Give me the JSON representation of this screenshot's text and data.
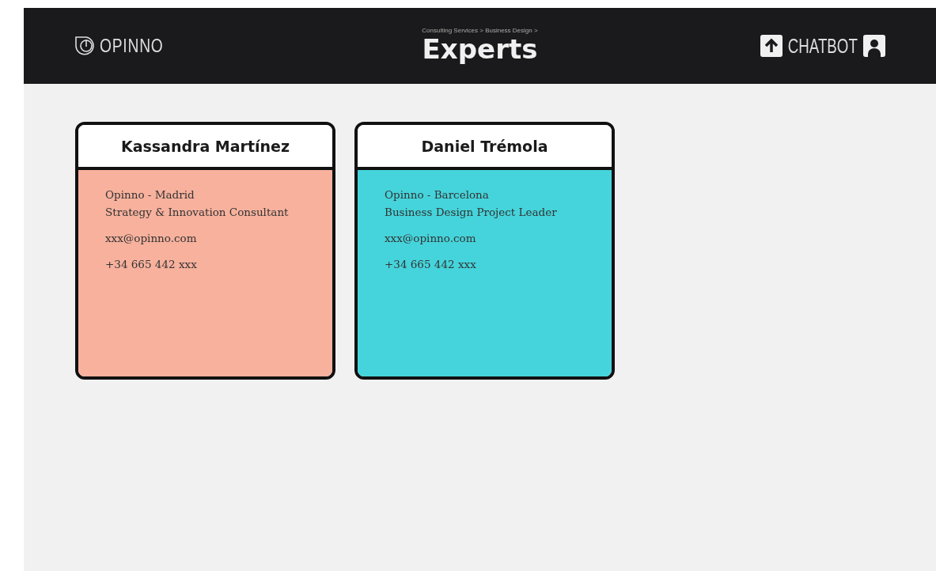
{
  "header": {
    "logo": "OPINNO",
    "breadcrumb": "Consulting Services > Business Design >",
    "title": "Experts",
    "chatbot": "CHATBOT"
  },
  "experts": [
    {
      "name": "Kassandra Martínez",
      "office": "Opinno - Madrid",
      "role": "Strategy & Innovation Consultant",
      "email": "xxx@opinno.com",
      "phone": "+34 665 442 xxx",
      "color": "#f7b19d"
    },
    {
      "name": "Daniel Trémola",
      "office": "Opinno - Barcelona",
      "role": "Business Design Project Leader",
      "email": "xxx@opinno.com",
      "phone": "+34 665 442 xxx",
      "color": "#45d4db"
    }
  ]
}
